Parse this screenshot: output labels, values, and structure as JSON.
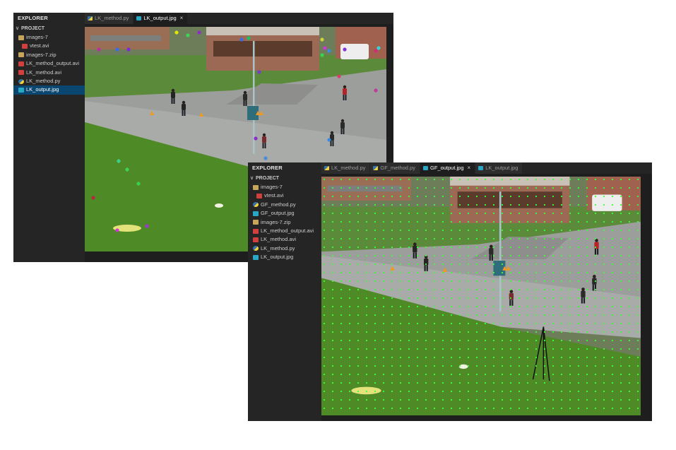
{
  "windows": [
    {
      "sidebar": {
        "title": "EXPLORER",
        "section": "PROJECT",
        "items": [
          {
            "label": "images-7",
            "icon": "folder-icon",
            "kind": "folder",
            "depth": 1
          },
          {
            "label": "vtest.avi",
            "icon": "video-file-icon",
            "kind": "avi",
            "depth": 2
          },
          {
            "label": "images-7.zip",
            "icon": "zip-file-icon",
            "kind": "zip",
            "depth": 1
          },
          {
            "label": "LK_method_output.avi",
            "icon": "video-file-icon",
            "kind": "avi",
            "depth": 1
          },
          {
            "label": "LK_method.avi",
            "icon": "video-file-icon",
            "kind": "avi",
            "depth": 1
          },
          {
            "label": "LK_method.py",
            "icon": "python-file-icon",
            "kind": "py",
            "depth": 1
          },
          {
            "label": "LK_output.jpg",
            "icon": "image-file-icon",
            "kind": "jpg",
            "depth": 1,
            "selected": true
          }
        ]
      },
      "tabs": [
        {
          "label": "LK_method.py",
          "icon": "python-file-icon",
          "kind": "py"
        },
        {
          "label": "LK_output.jpg",
          "icon": "image-file-icon",
          "kind": "jpg",
          "active": true,
          "close": "×"
        }
      ]
    },
    {
      "sidebar": {
        "title": "EXPLORER",
        "section": "PROJECT",
        "items": [
          {
            "label": "images-7",
            "icon": "folder-icon",
            "kind": "folder",
            "depth": 1
          },
          {
            "label": "vtest.avi",
            "icon": "video-file-icon",
            "kind": "avi",
            "depth": 2
          },
          {
            "label": "GF_method.py",
            "icon": "python-file-icon",
            "kind": "py",
            "depth": 1
          },
          {
            "label": "GF_output.jpg",
            "icon": "image-file-icon",
            "kind": "jpg",
            "depth": 1
          },
          {
            "label": "images-7.zip",
            "icon": "zip-file-icon",
            "kind": "zip",
            "depth": 1
          },
          {
            "label": "LK_method_output.avi",
            "icon": "video-file-icon",
            "kind": "avi",
            "depth": 1
          },
          {
            "label": "LK_method.avi",
            "icon": "video-file-icon",
            "kind": "avi",
            "depth": 1
          },
          {
            "label": "LK_method.py",
            "icon": "python-file-icon",
            "kind": "py",
            "depth": 1
          },
          {
            "label": "LK_output.jpg",
            "icon": "image-file-icon",
            "kind": "jpg",
            "depth": 1
          }
        ]
      },
      "tabs": [
        {
          "label": "LK_method.py",
          "icon": "python-file-icon",
          "kind": "py"
        },
        {
          "label": "GF_method.py",
          "icon": "python-file-icon",
          "kind": "py"
        },
        {
          "label": "GF_output.jpg",
          "icon": "image-file-icon",
          "kind": "jpg",
          "active": true,
          "close": "×"
        },
        {
          "label": "LK_output.jpg",
          "icon": "image-file-icon",
          "kind": "jpg"
        }
      ]
    }
  ],
  "colors": {
    "editor_bg": "#1e1e1e",
    "sidebar_bg": "#252526",
    "selection": "#094771",
    "grass": "#4f8a24",
    "pavement": "#a8aaa9",
    "flow_point": "#3cff3c"
  }
}
